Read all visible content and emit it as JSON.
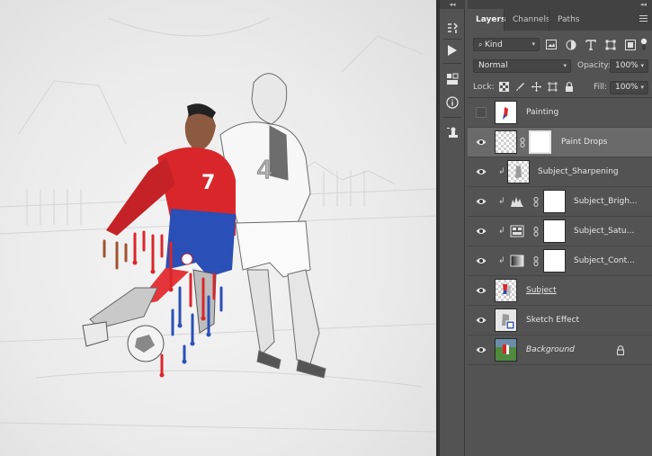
{
  "panel": {
    "collapse_glyph": "◂◂",
    "tabs": [
      {
        "label": "Layers",
        "active": true
      },
      {
        "label": "Channels",
        "active": false
      },
      {
        "label": "Paths",
        "active": false
      }
    ],
    "filter": {
      "kind_label": "Kind",
      "search_icon": "search-icon"
    },
    "blend_mode": "Normal",
    "opacity_label": "Opacity:",
    "opacity_value": "100%",
    "lock_label": "Lock:",
    "fill_label": "Fill:",
    "fill_value": "100%"
  },
  "layers": [
    {
      "name": "Painting",
      "visible": false,
      "selected": false,
      "clipped": false,
      "style": "normal",
      "type": "pixel"
    },
    {
      "name": "Paint Drops",
      "visible": true,
      "selected": true,
      "clipped": false,
      "style": "normal",
      "type": "masked"
    },
    {
      "name": "Subject_Sharpening",
      "visible": true,
      "selected": false,
      "clipped": true,
      "style": "normal",
      "type": "pixel"
    },
    {
      "name": "Subject_Brigh...",
      "visible": true,
      "selected": false,
      "clipped": true,
      "style": "normal",
      "type": "adjustment",
      "adjustment_icon": "levels-icon"
    },
    {
      "name": "Subject_Satu...",
      "visible": true,
      "selected": false,
      "clipped": true,
      "style": "normal",
      "type": "adjustment",
      "adjustment_icon": "hue-saturation-icon"
    },
    {
      "name": "Subject_Cont...",
      "visible": true,
      "selected": false,
      "clipped": true,
      "style": "normal",
      "type": "adjustment",
      "adjustment_icon": "gradient-icon"
    },
    {
      "name": "Subject",
      "visible": true,
      "selected": false,
      "clipped": false,
      "style": "underlined",
      "type": "pixel"
    },
    {
      "name": "Sketch Effect",
      "visible": true,
      "selected": false,
      "clipped": false,
      "style": "normal",
      "type": "pixel"
    },
    {
      "name": "Background",
      "visible": true,
      "selected": false,
      "clipped": false,
      "style": "italic",
      "type": "locked"
    }
  ],
  "colors": {
    "panel_bg": "#535353",
    "tab_bar_bg": "#424242",
    "selected_row": "#6a6a6a",
    "jersey_red": "#d9262b",
    "shorts_blue": "#2a4fb6"
  }
}
